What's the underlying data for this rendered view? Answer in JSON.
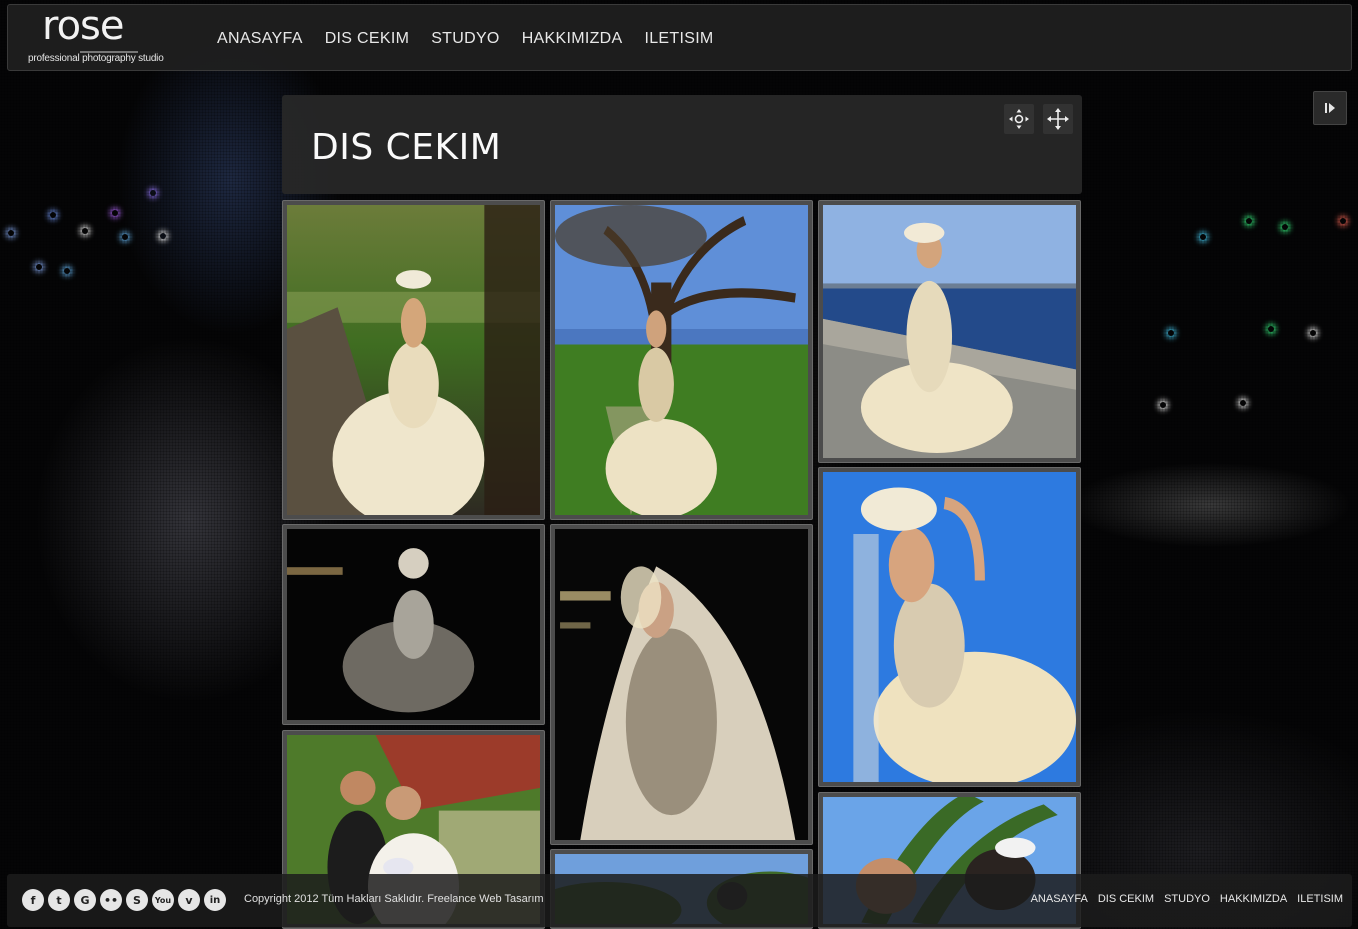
{
  "site": {
    "logo_word": "rose",
    "logo_tagline": "professional photography studio"
  },
  "nav": [
    {
      "label": "ANASAYFA"
    },
    {
      "label": "DIS CEKIM"
    },
    {
      "label": "STUDYO"
    },
    {
      "label": "HAKKIMIZDA"
    },
    {
      "label": "ILETISIM"
    }
  ],
  "page": {
    "title": "DIS CEKIM"
  },
  "controls": {
    "settings_icon": "fullscreen-settings-icon",
    "move_icon": "move-arrows-icon",
    "play_icon": "play-pause-icon"
  },
  "gallery": [
    {
      "name": "bride-park-path"
    },
    {
      "name": "bride-under-tree"
    },
    {
      "name": "bride-seaside"
    },
    {
      "name": "bride-night-1"
    },
    {
      "name": "bride-night-2"
    },
    {
      "name": "bride-blue-sky"
    },
    {
      "name": "couple-gazebo"
    },
    {
      "name": "couple-trees"
    },
    {
      "name": "couple-palm"
    }
  ],
  "footer": {
    "socials": [
      {
        "icon": "facebook-icon",
        "glyph": "f"
      },
      {
        "icon": "twitter-icon",
        "glyph": "t"
      },
      {
        "icon": "google-icon",
        "glyph": "G"
      },
      {
        "icon": "flickr-icon",
        "glyph": "••"
      },
      {
        "icon": "skype-icon",
        "glyph": "S"
      },
      {
        "icon": "youtube-icon",
        "glyph": "You"
      },
      {
        "icon": "vimeo-icon",
        "glyph": "v"
      },
      {
        "icon": "linkedin-icon",
        "glyph": "in"
      }
    ],
    "copyright": "Copyright 2012 Tüm Hakları Saklıdır. Freelance Web Tasarım",
    "links": [
      {
        "label": "ANASAYFA"
      },
      {
        "label": "DIS CEKIM"
      },
      {
        "label": "STUDYO"
      },
      {
        "label": "HAKKIMIZDA"
      },
      {
        "label": "ILETISIM"
      }
    ]
  },
  "colors": {
    "panel": "#282828",
    "tile_border": "#4c4c4c",
    "text": "#ffffff"
  }
}
